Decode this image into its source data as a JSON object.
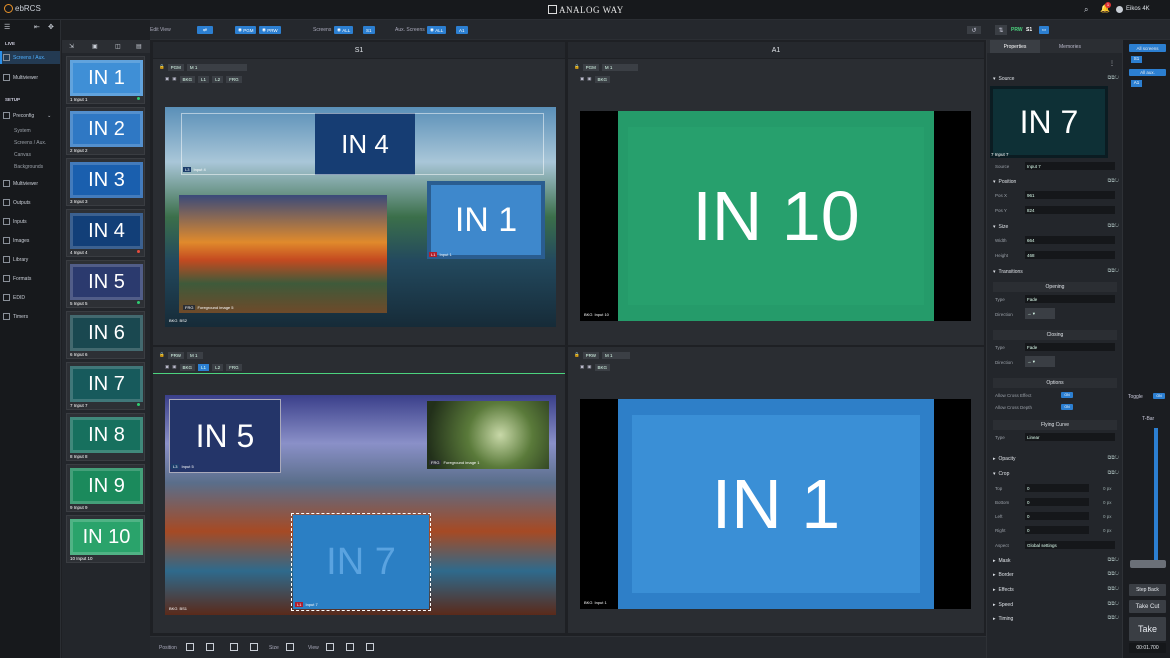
{
  "app": {
    "name": "ebRCS",
    "brand": "ANALOG WAY",
    "user": "Eikos 4K",
    "notifications": "1"
  },
  "sidebar": {
    "sections": [
      "LIVE",
      "SETUP"
    ],
    "live_items": [
      "Screens / Aux.",
      "Multiviewer"
    ],
    "preconfig": "Preconfig",
    "preconfig_sub": [
      "System",
      "Screens / Aux.",
      "Canvas",
      "Backgrounds"
    ],
    "setup_items": [
      "Multiviewer",
      "Outputs",
      "Inputs",
      "Images",
      "Library",
      "Formats",
      "EDID",
      "Timers"
    ]
  },
  "toolbar": {
    "edit_view": "Edit View",
    "pgm": "PGM",
    "prw": "PRW",
    "screens_label": "Screens",
    "screens_all": "ALL",
    "screens_s1": "S1",
    "aux_label": "Aux. Screens",
    "aux_all": "ALL",
    "aux_a1": "A1",
    "prw_label": "PRW",
    "prw_screen": "S1"
  },
  "inputs": [
    {
      "tile": "IN 1",
      "label": "1  Input 1",
      "color": "#3f8fd6",
      "dot": "#2ecc71"
    },
    {
      "tile": "IN 2",
      "label": "2  Input 2",
      "color": "#2f78c4",
      "dot": ""
    },
    {
      "tile": "IN 3",
      "label": "3  Input 3",
      "color": "#1a5fae",
      "dot": ""
    },
    {
      "tile": "IN 4",
      "label": "4  Input 4",
      "color": "#123f78",
      "dot": "#e74c3c"
    },
    {
      "tile": "IN 5",
      "label": "5  Input 5",
      "color": "#2b3a6e",
      "dot": "#2ecc71"
    },
    {
      "tile": "IN 6",
      "label": "6  Input 6",
      "color": "#1a4850",
      "dot": ""
    },
    {
      "tile": "IN 7",
      "label": "7  Input 7",
      "color": "#175a5c",
      "dot": "#2ecc71"
    },
    {
      "tile": "IN 8",
      "label": "8  Input 8",
      "color": "#17705e",
      "dot": ""
    },
    {
      "tile": "IN 9",
      "label": "9  Input 9",
      "color": "#1b8a5c",
      "dot": ""
    },
    {
      "tile": "IN 10",
      "label": "10  Input 10",
      "color": "#2aa36b",
      "dot": ""
    }
  ],
  "screens": {
    "s1_title": "S1",
    "a1_title": "A1",
    "pgm_tag": "PGM",
    "prw_tag": "PRW",
    "preset": "M 1",
    "s1_pgm": {
      "layers": [
        {
          "text": "IN 4",
          "badge_k": "L3",
          "badge": "Input 4"
        },
        {
          "text": "IN 1",
          "badge_k": "L1",
          "badge": "Input 1"
        },
        {
          "text": "",
          "badge_k": "FRG",
          "badge": "Foreground image 5"
        }
      ],
      "bkg": "BKG",
      "bkg_name": "BS2"
    },
    "a1_pgm": {
      "text": "IN 10",
      "bkg": "BKG",
      "bkg_name": "Input 10"
    },
    "s1_prw": {
      "layers": [
        {
          "text": "IN 5",
          "badge_k": "L3",
          "badge": "Input 5"
        },
        {
          "text": "IN 7",
          "badge_k": "L1",
          "badge": "Input 7"
        },
        {
          "text": "",
          "badge_k": "FRG",
          "badge": "Foreground image 1"
        }
      ],
      "bkg": "BKG",
      "bkg_name": "BS1"
    },
    "a1_prw": {
      "text": "IN 1",
      "bkg": "BKG",
      "bkg_name": "Input 1"
    }
  },
  "properties": {
    "tab_properties": "Properties",
    "tab_memories": "Memories",
    "source_title": "Source",
    "source_preview": "IN 7",
    "source_label": "7  Input 7",
    "source_field_label": "Source",
    "source_value": "Input 7",
    "position_title": "Position",
    "pos_x_label": "Pos X",
    "pos_x": "961",
    "pos_y_label": "Pos Y",
    "pos_y": "824",
    "size_title": "Size",
    "width_label": "Width",
    "width": "664",
    "height_label": "Height",
    "height": "468",
    "transitions_title": "Transitions",
    "opening": "Opening",
    "closing": "Closing",
    "options": "Options",
    "flying_curve": "Flying Curve",
    "type_label": "Type",
    "direction_label": "Direction",
    "opening_type": "Fade",
    "closing_type": "Fade",
    "curve_type": "Linear",
    "cross_effect": "Allow Cross Effect",
    "cross_depth": "Allow Cross Depth",
    "on": "ON",
    "opacity": "Opacity",
    "crop": "Crop",
    "crop_top": "Top",
    "crop_bottom": "Bottom",
    "crop_left": "Left",
    "crop_right": "Right",
    "crop_aspect": "Aspect",
    "crop_value": "0",
    "px": "0 px",
    "aspect_value": "Global settings",
    "mask": "Mask",
    "border": "Border",
    "effects": "Effects",
    "speed": "Speed",
    "timing": "Timing"
  },
  "take_panel": {
    "all_screens": "All screens",
    "s1": "S1",
    "all_aux": "All aux.",
    "a1": "A1",
    "toggle": "Toggle",
    "toggle_state": "ON",
    "tbar": "T-Bar",
    "step_back": "Step Back",
    "take_cut": "Take Cut",
    "take": "Take",
    "time": "00:01.700"
  },
  "bottom": {
    "position": "Position",
    "size": "Size",
    "view": "View"
  }
}
